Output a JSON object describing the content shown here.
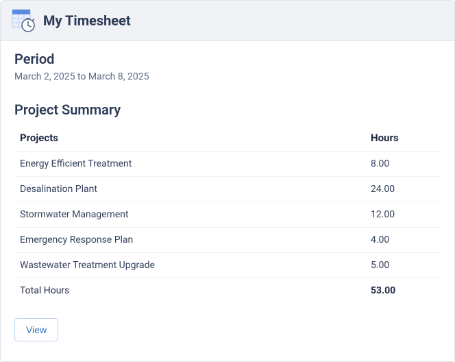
{
  "header": {
    "title": "My Timesheet",
    "icon": "timesheet-icon"
  },
  "period": {
    "label": "Period",
    "text": "March 2, 2025 to March 8, 2025"
  },
  "summary": {
    "label": "Project Summary",
    "columns": {
      "projects": "Projects",
      "hours": "Hours"
    },
    "rows": [
      {
        "project": "Energy Efficient Treatment",
        "hours": "8.00"
      },
      {
        "project": "Desalination Plant",
        "hours": "24.00"
      },
      {
        "project": "Stormwater Management",
        "hours": "12.00"
      },
      {
        "project": "Emergency Response Plan",
        "hours": "4.00"
      },
      {
        "project": "Wastewater Treatment Upgrade",
        "hours": "5.00"
      }
    ],
    "total": {
      "label": "Total Hours",
      "hours": "53.00"
    }
  },
  "actions": {
    "view_label": "View"
  },
  "colors": {
    "accent": "#2f6fd0",
    "header_bg": "#f0f2f5",
    "text_primary": "#1f2a44",
    "text_muted": "#5a6b87"
  }
}
